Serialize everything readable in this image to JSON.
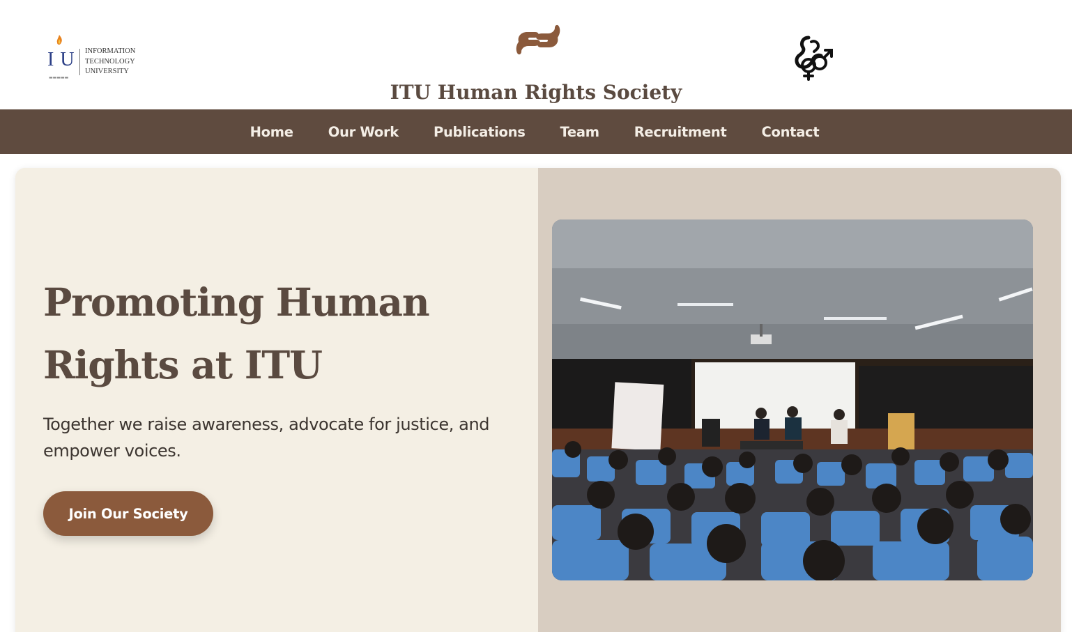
{
  "header": {
    "university_logo": {
      "letters": "I U",
      "lines": [
        "INFORMATION",
        "TECHNOLOGY",
        "UNIVERSITY"
      ],
      "icon": "torch-icon"
    },
    "center_icon": "hands-icon",
    "title": "ITU Human Rights Society",
    "right_icon": "gender-symbols-icon"
  },
  "nav": {
    "items": [
      {
        "label": "Home"
      },
      {
        "label": "Our Work"
      },
      {
        "label": "Publications"
      },
      {
        "label": "Team"
      },
      {
        "label": "Recruitment"
      },
      {
        "label": "Contact"
      }
    ]
  },
  "hero": {
    "title": "Promoting Human Rights at ITU",
    "subtitle": "Together we raise awareness, advocate for justice, and empower voices.",
    "cta_label": "Join Our Society",
    "image_alt": "Panel discussion in a lecture hall with students in blue seats"
  },
  "colors": {
    "brand_brown": "#5f4b3f",
    "accent_brown": "#8b5a3c",
    "title_brown": "#5a4a40",
    "hero_left_bg": "#f4efe4",
    "hero_right_bg": "#d8cdc1",
    "itu_blue": "#2a3e86"
  }
}
